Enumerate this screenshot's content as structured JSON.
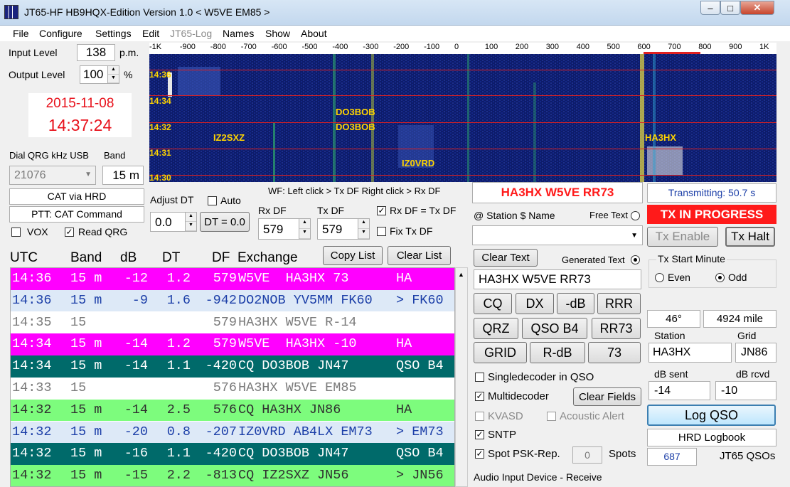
{
  "window": {
    "title": "JT65-HF HB9HQX-Edition Version 1.0   < W5VE EM85 >"
  },
  "menu": [
    "File",
    "Configure",
    "Settings",
    "Edit",
    "JT65-Log",
    "Names",
    "Show",
    "About"
  ],
  "levels": {
    "input_label": "Input Level",
    "input_value": "138",
    "input_unit": "p.m.",
    "output_label": "Output Level",
    "output_value": "100",
    "output_unit": "%"
  },
  "clock": {
    "date": "2015-11-08",
    "time": "14:37:24"
  },
  "dial": {
    "label": "Dial QRG kHz USB",
    "value": "21076",
    "band_label": "Band",
    "band_value": "15 m"
  },
  "cat": {
    "rig": "CAT via HRD",
    "ptt": "PTT: CAT Command",
    "vox": "VOX",
    "read_qrg": "Read QRG"
  },
  "dt": {
    "label": "Adjust DT",
    "value": "0.0",
    "auto": "Auto",
    "reset": "DT = 0.0"
  },
  "wf": {
    "hint": "WF: Left click > Tx DF  Right click > Rx DF",
    "scale": [
      "-1K",
      "-900",
      "-800",
      "-700",
      "-600",
      "-500",
      "-400",
      "-300",
      "-200",
      "-100",
      "0",
      "100",
      "200",
      "300",
      "400",
      "500",
      "600",
      "700",
      "800",
      "900",
      "1K"
    ],
    "times": [
      "14:36",
      "14:34",
      "14:32",
      "14:31",
      "14:30"
    ],
    "calls": [
      "DO3BOB",
      "DO3BOB",
      "IZ2SXZ",
      "HA3HX",
      "IZ0VRD"
    ]
  },
  "rxtx": {
    "rx_label": "Rx DF",
    "rx_value": "579",
    "tx_label": "Tx DF",
    "tx_value": "579",
    "rx_eq_tx": "Rx DF = Tx DF",
    "fix_tx": "Fix Tx DF"
  },
  "list": {
    "headers": [
      "UTC",
      "Band",
      "dB",
      "DT",
      "DF",
      "Exchange"
    ],
    "copy": "Copy List",
    "clear": "Clear List",
    "rows": [
      {
        "utc": "14:36",
        "band": "15 m",
        "db": "-12",
        "dt": "1.2",
        "df": "579",
        "ex": "W5VE  HA3HX 73",
        "note": "HA",
        "bg": "#ff00ff",
        "fg": "#ffffff"
      },
      {
        "utc": "14:36",
        "band": "15 m",
        "db": "-9",
        "dt": "1.6",
        "df": "-942",
        "ex": "DO2NOB YV5MM FK60",
        "note": "> FK60",
        "bg": "#dde9f7",
        "fg": "#1c3fa8"
      },
      {
        "utc": "14:35",
        "band": "15",
        "db": "",
        "dt": "",
        "df": "579",
        "ex": "HA3HX W5VE R-14",
        "note": "",
        "bg": "#ffffff",
        "fg": "#7a7a7a"
      },
      {
        "utc": "14:34",
        "band": "15 m",
        "db": "-14",
        "dt": "1.2",
        "df": "579",
        "ex": "W5VE  HA3HX -10",
        "note": "HA",
        "bg": "#ff00ff",
        "fg": "#ffffff"
      },
      {
        "utc": "14:34",
        "band": "15 m",
        "db": "-14",
        "dt": "1.1",
        "df": "-420",
        "ex": "CQ DO3BOB JN47",
        "note": "QSO B4",
        "bg": "#006a6a",
        "fg": "#ffffff"
      },
      {
        "utc": "14:33",
        "band": "15",
        "db": "",
        "dt": "",
        "df": "576",
        "ex": "HA3HX W5VE EM85",
        "note": "",
        "bg": "#ffffff",
        "fg": "#7a7a7a"
      },
      {
        "utc": "14:32",
        "band": "15 m",
        "db": "-14",
        "dt": "2.5",
        "df": "576",
        "ex": "CQ HA3HX JN86",
        "note": "HA",
        "bg": "#7dfc7d",
        "fg": "#303030"
      },
      {
        "utc": "14:32",
        "band": "15 m",
        "db": "-20",
        "dt": "0.8",
        "df": "-207",
        "ex": "IZ0VRD AB4LX EM73",
        "note": "> EM73",
        "bg": "#dde9f7",
        "fg": "#1c3fa8"
      },
      {
        "utc": "14:32",
        "band": "15 m",
        "db": "-16",
        "dt": "1.1",
        "df": "-420",
        "ex": "CQ DO3BOB JN47",
        "note": "QSO B4",
        "bg": "#006a6a",
        "fg": "#ffffff"
      },
      {
        "utc": "14:32",
        "band": "15 m",
        "db": "-15",
        "dt": "2.2",
        "df": "-813",
        "ex": "CQ IZ2SXZ JN56",
        "note": "> JN56",
        "bg": "#7dfc7d",
        "fg": "#303030"
      }
    ]
  },
  "qso": {
    "last": "HA3HX W5VE RR73",
    "station_label": "@ Station  $ Name",
    "free_text": "Free Text",
    "clear_text": "Clear Text",
    "generated_text": "Generated Text",
    "generated_value": "HA3HX W5VE RR73",
    "buttons": [
      "CQ",
      "DX",
      "-dB",
      "RRR",
      "QRZ",
      "QSO B4",
      "RR73",
      "GRID",
      "R-dB",
      "73"
    ],
    "single": "Singledecoder in QSO",
    "multi": "Multidecoder",
    "clear_fields": "Clear Fields",
    "kvasd": "KVASD",
    "acoustic": "Acoustic Alert",
    "sntp": "SNTP",
    "spot": "Spot PSK-Rep.",
    "spots_value": "0",
    "spots_label": "Spots",
    "audio": "Audio Input Device - Receive"
  },
  "tx": {
    "transmitting": "Transmitting: 50.7 s",
    "status": "TX IN PROGRESS",
    "enable": "Tx Enable",
    "halt": "Tx Halt",
    "minute_label": "Tx Start Minute",
    "even": "Even",
    "odd": "Odd"
  },
  "station": {
    "azimuth": "46°",
    "distance": "4924 mile",
    "station_label": "Station",
    "grid_label": "Grid",
    "station_value": "HA3HX",
    "grid_value": "JN86",
    "sent_label": "dB sent",
    "rcvd_label": "dB rcvd",
    "sent_value": "-14",
    "rcvd_value": "-10",
    "log_qso": "Log QSO",
    "logbook": "HRD Logbook",
    "qso_count": "687",
    "qso_label": "JT65 QSOs"
  },
  "colors": {
    "tx_red": "#ff1a1a",
    "date_red": "#e8121c",
    "waterfall_bg": "#0d1c6b"
  }
}
